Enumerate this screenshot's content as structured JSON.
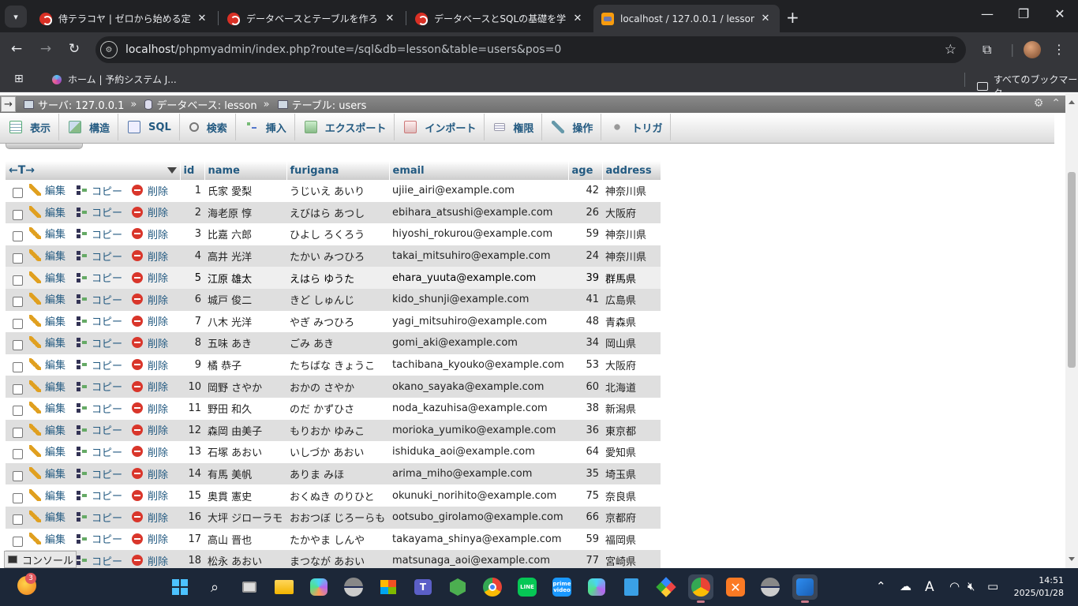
{
  "browser": {
    "tabs": [
      {
        "title": "侍テラコヤ | ゼロから始める定額・学",
        "favicon": "samurai-icon",
        "active": false
      },
      {
        "title": "データベースとテーブルを作ろう | プロ",
        "favicon": "samurai-icon",
        "active": false
      },
      {
        "title": "データベースとSQLの基礎を学ぼう |",
        "favicon": "samurai-icon",
        "active": false
      },
      {
        "title": "localhost / 127.0.0.1 / lesson / u",
        "favicon": "phpmyadmin-icon",
        "active": true
      }
    ],
    "new_tab": "+",
    "url_host": "localhost",
    "url_path": "/phpmyadmin/index.php?route=/sql&db=lesson&table=users&pos=0",
    "bookmarks": [
      {
        "label": "ホーム | 予約システム J..."
      }
    ],
    "all_bookmarks": "すべてのブックマーク"
  },
  "pma": {
    "breadcrumb": {
      "server": "サーバ: 127.0.0.1",
      "database": "データベース: lesson",
      "table": "テーブル: users"
    },
    "menu": [
      {
        "label": "表示",
        "icon": "browse-icon"
      },
      {
        "label": "構造",
        "icon": "structure-icon"
      },
      {
        "label": "SQL",
        "icon": "sql-icon"
      },
      {
        "label": "検索",
        "icon": "search-icon"
      },
      {
        "label": "挿入",
        "icon": "insert-icon"
      },
      {
        "label": "エクスポート",
        "icon": "export-icon"
      },
      {
        "label": "インポート",
        "icon": "import-icon"
      },
      {
        "label": "権限",
        "icon": "privileges-icon"
      },
      {
        "label": "操作",
        "icon": "operations-icon"
      },
      {
        "label": "トリガ",
        "icon": "triggers-icon"
      }
    ],
    "table": {
      "header_arrows": "←T→",
      "columns": [
        "id",
        "name",
        "furigana",
        "email",
        "age",
        "address"
      ],
      "actions": {
        "edit": "編集",
        "copy": "コピー",
        "delete": "削除"
      },
      "rows": [
        {
          "id": "1",
          "name": "氏家 愛梨",
          "furigana": "うじいえ あいり",
          "email": "ujiie_airi@example.com",
          "age": "42",
          "address": "神奈川県"
        },
        {
          "id": "2",
          "name": "海老原 惇",
          "furigana": "えびはら あつし",
          "email": "ebihara_atsushi@example.com",
          "age": "26",
          "address": "大阪府"
        },
        {
          "id": "3",
          "name": "比嘉 六郎",
          "furigana": "ひよし ろくろう",
          "email": "hiyoshi_rokurou@example.com",
          "age": "59",
          "address": "神奈川県"
        },
        {
          "id": "4",
          "name": "高井 光洋",
          "furigana": "たかい みつひろ",
          "email": "takai_mitsuhiro@example.com",
          "age": "24",
          "address": "神奈川県"
        },
        {
          "id": "5",
          "name": "江原 雄太",
          "furigana": "えはら ゆうた",
          "email": "ehara_yuuta@example.com",
          "age": "39",
          "address": "群馬県"
        },
        {
          "id": "6",
          "name": "城戸 俊二",
          "furigana": "きど しゅんじ",
          "email": "kido_shunji@example.com",
          "age": "41",
          "address": "広島県"
        },
        {
          "id": "7",
          "name": "八木 光洋",
          "furigana": "やぎ みつひろ",
          "email": "yagi_mitsuhiro@example.com",
          "age": "48",
          "address": "青森県"
        },
        {
          "id": "8",
          "name": "五味 あき",
          "furigana": "ごみ あき",
          "email": "gomi_aki@example.com",
          "age": "34",
          "address": "岡山県"
        },
        {
          "id": "9",
          "name": "橘 恭子",
          "furigana": "たちばな きょうこ",
          "email": "tachibana_kyouko@example.com",
          "age": "53",
          "address": "大阪府"
        },
        {
          "id": "10",
          "name": "岡野 さやか",
          "furigana": "おかの さやか",
          "email": "okano_sayaka@example.com",
          "age": "60",
          "address": "北海道"
        },
        {
          "id": "11",
          "name": "野田 和久",
          "furigana": "のだ かずひさ",
          "email": "noda_kazuhisa@example.com",
          "age": "38",
          "address": "新潟県"
        },
        {
          "id": "12",
          "name": "森岡 由美子",
          "furigana": "もりおか ゆみこ",
          "email": "morioka_yumiko@example.com",
          "age": "36",
          "address": "東京都"
        },
        {
          "id": "13",
          "name": "石塚 あおい",
          "furigana": "いしづか あおい",
          "email": "ishiduka_aoi@example.com",
          "age": "64",
          "address": "愛知県"
        },
        {
          "id": "14",
          "name": "有馬 美帆",
          "furigana": "ありま みほ",
          "email": "arima_miho@example.com",
          "age": "35",
          "address": "埼玉県"
        },
        {
          "id": "15",
          "name": "奥貫 憲史",
          "furigana": "おくぬき のりひと",
          "email": "okunuki_norihito@example.com",
          "age": "75",
          "address": "奈良県"
        },
        {
          "id": "16",
          "name": "大坪 ジローラモ",
          "furigana": "おおつぼ じろーらも",
          "email": "ootsubo_girolamo@example.com",
          "age": "66",
          "address": "京都府"
        },
        {
          "id": "17",
          "name": "高山 晋也",
          "furigana": "たかやま しんや",
          "email": "takayama_shinya@example.com",
          "age": "59",
          "address": "福岡県"
        },
        {
          "id": "18",
          "name": "松永 あおい",
          "furigana": "まつなが あおい",
          "email": "matsunaga_aoi@example.com",
          "age": "77",
          "address": "宮崎県"
        }
      ]
    },
    "console_label": "コンソール"
  },
  "taskbar": {
    "weather_badge": "3",
    "time": "14:51",
    "date": "2025/01/28",
    "ime": "A"
  }
}
